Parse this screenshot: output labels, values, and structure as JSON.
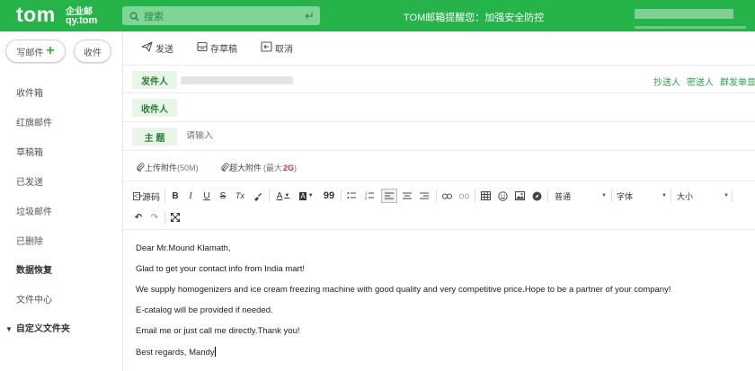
{
  "header": {
    "logo_main": "tom",
    "logo_sub1": "企业邮",
    "logo_sub2": "qy.tom",
    "search_placeholder": "搜索",
    "notice": "TOM邮箱提醒您：加强安全防控"
  },
  "sidebar": {
    "compose_label": "写邮件",
    "receive_label": "收件",
    "items": [
      {
        "label": "收件箱"
      },
      {
        "label": "红旗邮件"
      },
      {
        "label": "草稿箱"
      },
      {
        "label": "已发送"
      },
      {
        "label": "垃圾邮件"
      },
      {
        "label": "已删除"
      },
      {
        "label": "数据恢复"
      },
      {
        "label": "文件中心"
      },
      {
        "label": "自定义文件夹"
      }
    ]
  },
  "toolbar": {
    "send_label": "发送",
    "draft_label": "存草稿",
    "cancel_label": "取消"
  },
  "compose": {
    "from_label": "发件人",
    "to_label": "收件人",
    "subject_label": "主 题",
    "subject_placeholder": "请输入",
    "cc_links": [
      "抄送人",
      "密送人",
      "群发单显"
    ]
  },
  "attachments": {
    "upload_label": "上传附件",
    "upload_limit": "(50M)",
    "large_label": "超大附件",
    "large_limit_prefix": "(最大",
    "large_limit_value": "2G",
    "large_limit_suffix": ")"
  },
  "editor": {
    "source_label": "源码",
    "bold": "B",
    "italic": "I",
    "underline": "U",
    "strike": "S",
    "clear_format": "Tx",
    "font_color": "A",
    "bg_color": "A",
    "quote": "99",
    "format_select": "普通",
    "font_select": "字体",
    "size_select": "大小"
  },
  "body": {
    "lines": [
      "Dear Mr.Mound Klamath,",
      "Glad to get your contact info from India mart!",
      "We supply homogenizers and ice cream freezing machine with good quality and very competitive price.Hope to be a partner of your company!",
      "E-catalog will be provided if needed.",
      "Email me or just call me directly.Thank you!",
      "Best regards, Mandy"
    ]
  },
  "colors": {
    "brand_green": "#25b34a",
    "label_bg": "#e8f6e8",
    "link_green": "#2fa24a",
    "size_red": "#d0312d"
  }
}
